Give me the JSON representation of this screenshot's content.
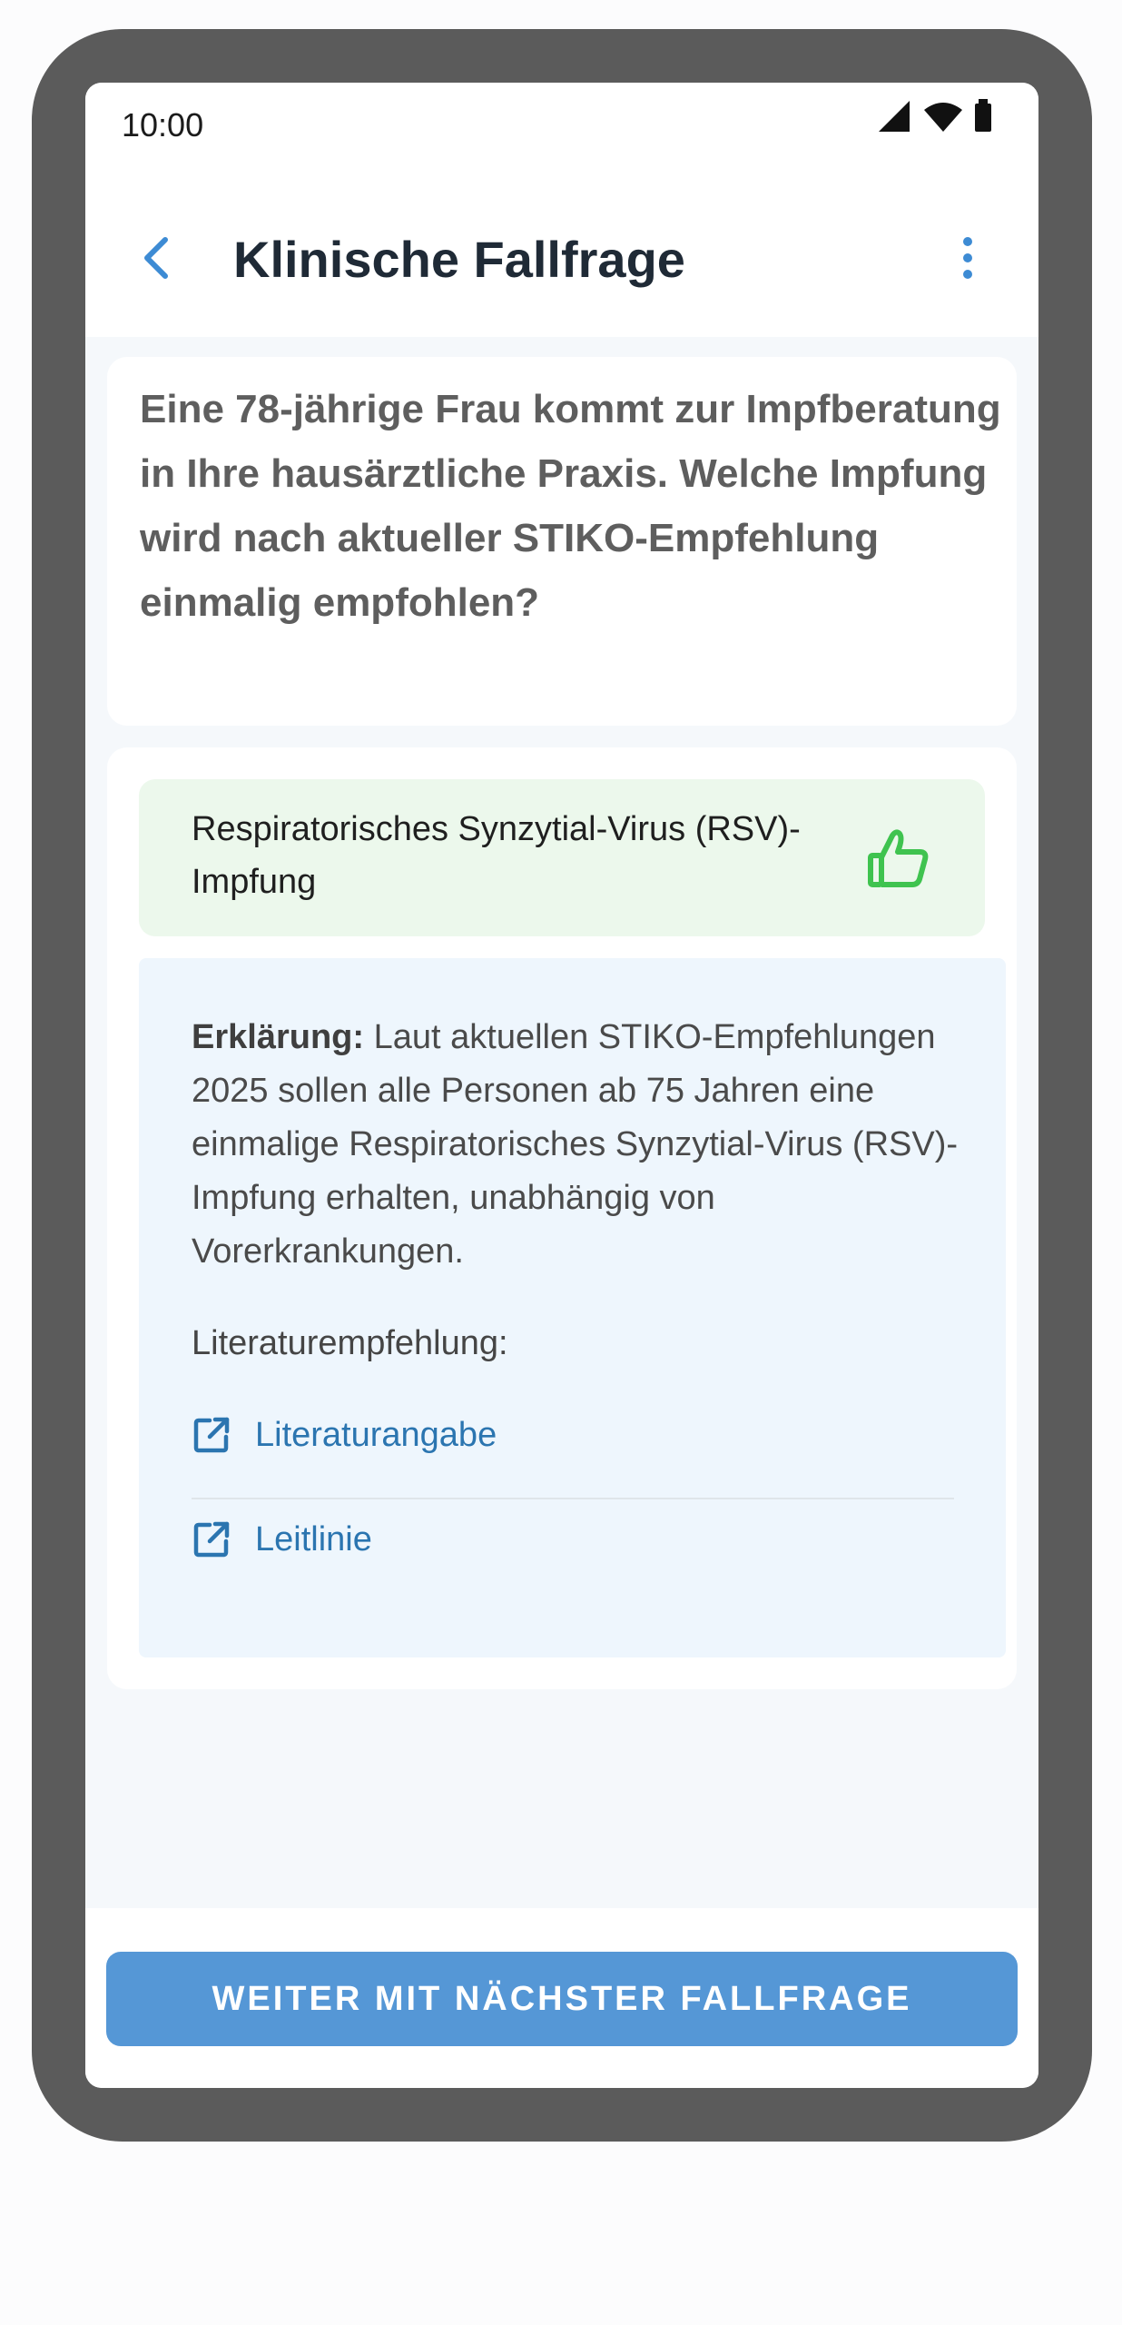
{
  "status_bar": {
    "time": "10:00",
    "icons": [
      "signal-icon",
      "wifi-icon",
      "battery-icon"
    ]
  },
  "header": {
    "title": "Klinische Fallfrage",
    "back_icon": "chevron-left-icon",
    "menu_icon": "more-vertical-icon"
  },
  "question": {
    "text": "Eine 78-jährige Frau kommt zur Impfberatung in Ihre hausärztliche Praxis. Welche Impfung wird nach aktueller STIKO-Empfehlung einmalig empfohlen?"
  },
  "answer": {
    "text": "Respiratorisches Synzytial-Virus (RSV)-Impfung",
    "icon": "thumbs-up-icon",
    "icon_color": "#3fc34f",
    "background": "#ecf8ec"
  },
  "explanation": {
    "label": "Erklärung:",
    "text": " Laut aktuellen STIKO-Empfehlungen 2025 sollen alle Personen ab 75 Jahren eine einmalige Respiratorisches Synzytial-Virus (RSV)-Impfung erhalten, unabhängig von Vorerkrankungen.",
    "literature_label": "Literaturempfehlung:",
    "links": [
      {
        "label": "Literaturangabe",
        "icon": "external-link-icon"
      },
      {
        "label": "Leitlinie",
        "icon": "external-link-icon"
      }
    ],
    "link_color": "#2b75b0"
  },
  "footer": {
    "next_label": "WEITER MIT NÄCHSTER FALLFRAGE",
    "button_color": "#5597d6"
  }
}
